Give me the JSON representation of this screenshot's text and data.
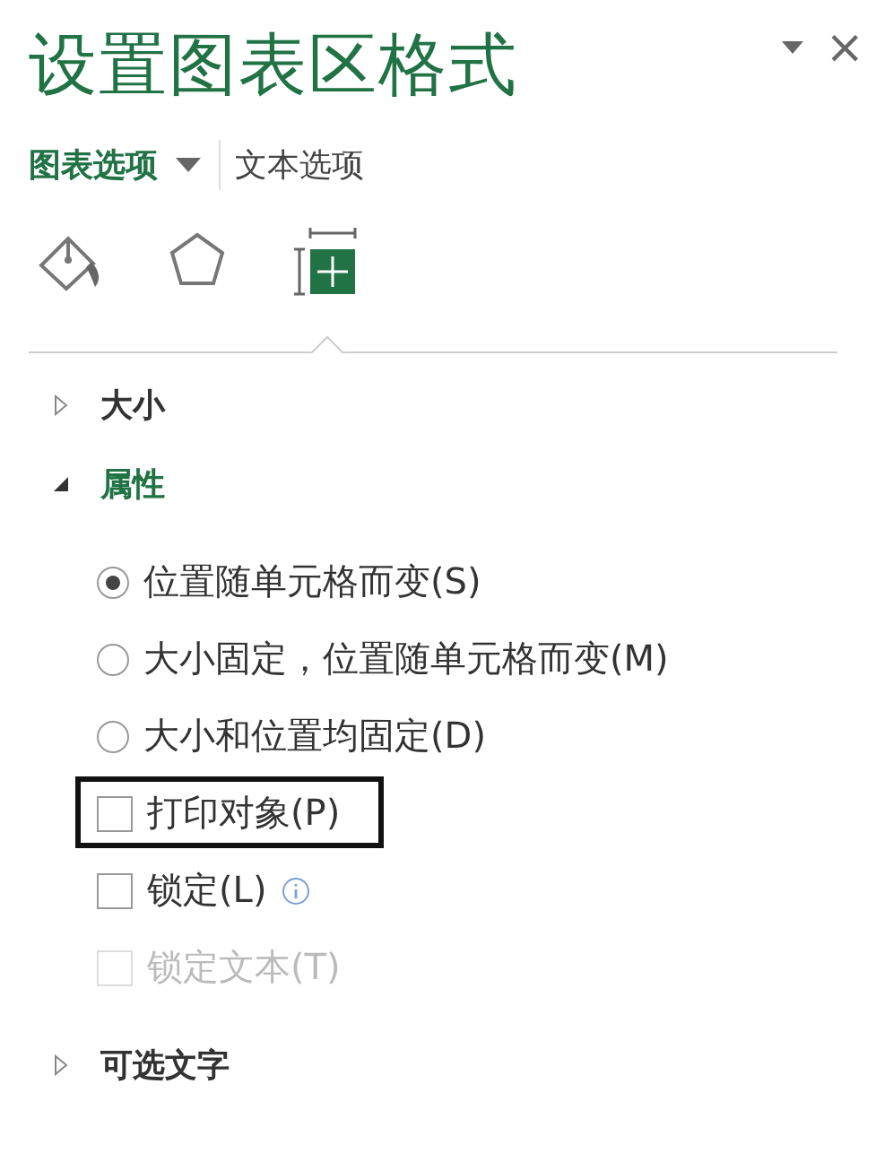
{
  "pane": {
    "title": "设置图表区格式",
    "close": "×"
  },
  "tabs": [
    {
      "label": "图表选项",
      "selected": true,
      "has_menu": true
    },
    {
      "label": "文本选项",
      "selected": false,
      "has_menu": false
    }
  ],
  "icon_tabs": [
    {
      "kind": "fill",
      "selected": false
    },
    {
      "kind": "effects",
      "selected": false
    },
    {
      "kind": "size",
      "selected": true
    }
  ],
  "sections": [
    {
      "title": "大小",
      "expanded": false
    },
    {
      "title": "属性",
      "expanded": true,
      "items": [
        {
          "kind": "radio",
          "label": "位置随单元格而变(S)",
          "selected": true
        },
        {
          "kind": "radio",
          "label": "大小固定，位置随单元格而变(M)",
          "selected": false
        },
        {
          "kind": "radio",
          "label": "大小和位置均固定(D)",
          "selected": false
        },
        {
          "kind": "checkbox",
          "label": "打印对象(P)",
          "checked": false,
          "focused": true
        },
        {
          "kind": "checkbox",
          "label": "锁定(L)",
          "checked": false,
          "info": true
        },
        {
          "kind": "checkbox",
          "label": "锁定文本(T)",
          "checked": false,
          "disabled": true
        }
      ]
    },
    {
      "title": "可选文字",
      "expanded": false
    }
  ]
}
